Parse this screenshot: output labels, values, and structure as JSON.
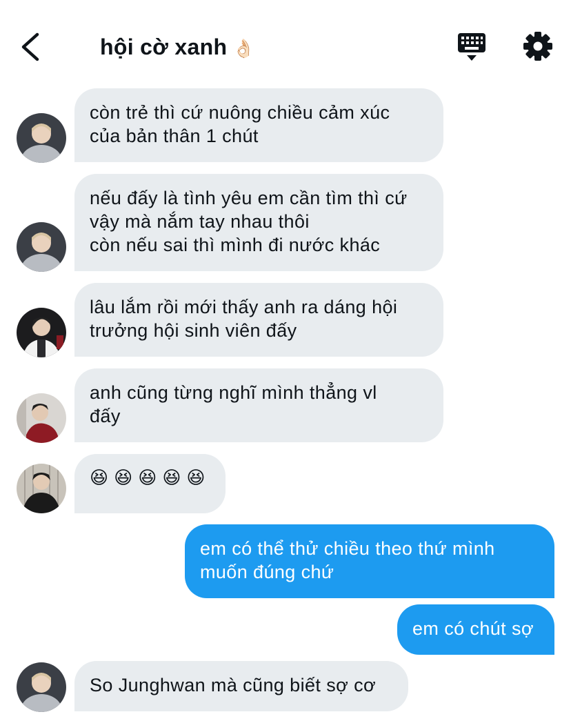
{
  "header": {
    "title": "hội cờ xanh",
    "title_emoji": "👌🏻",
    "back_icon": "chevron-left-icon",
    "keyboard_icon": "keyboard-icon",
    "settings_icon": "gear-icon"
  },
  "messages": [
    {
      "from": "other",
      "avatar": "avatar-gray-hoodie",
      "lines": [
        "còn trẻ thì cứ nuông chiều cảm xúc",
        "của bản thân 1 chút"
      ]
    },
    {
      "from": "other",
      "avatar": "avatar-gray-hoodie",
      "lines": [
        "nếu đấy là tình yêu em cần tìm thì cứ",
        "vậy mà nắm tay nhau thôi",
        "còn nếu sai thì mình đi nước khác"
      ]
    },
    {
      "from": "other",
      "avatar": "avatar-white-shirt",
      "lines": [
        "lâu lắm rồi mới thấy anh ra dáng hội",
        "trưởng hội sinh viên đấy"
      ]
    },
    {
      "from": "other",
      "avatar": "avatar-red-jacket",
      "lines": [
        "anh cũng từng nghĩ mình thẳng vl",
        "đấy"
      ]
    },
    {
      "from": "other",
      "avatar": "avatar-dark-jacket",
      "lines": [
        "😆😆😆😆😆"
      ]
    },
    {
      "from": "me",
      "lines": [
        "em có thể thử chiều theo thứ mình",
        "muốn đúng chứ"
      ]
    },
    {
      "from": "me",
      "lines": [
        "em có chút sợ"
      ]
    },
    {
      "from": "other",
      "avatar": "avatar-gray-hoodie",
      "lines": [
        "So Junghwan mà cũng biết sợ cơ"
      ]
    }
  ],
  "colors": {
    "incoming_bubble": "#e8ecef",
    "outgoing_bubble": "#1d9bf0",
    "text": "#0f1419"
  }
}
